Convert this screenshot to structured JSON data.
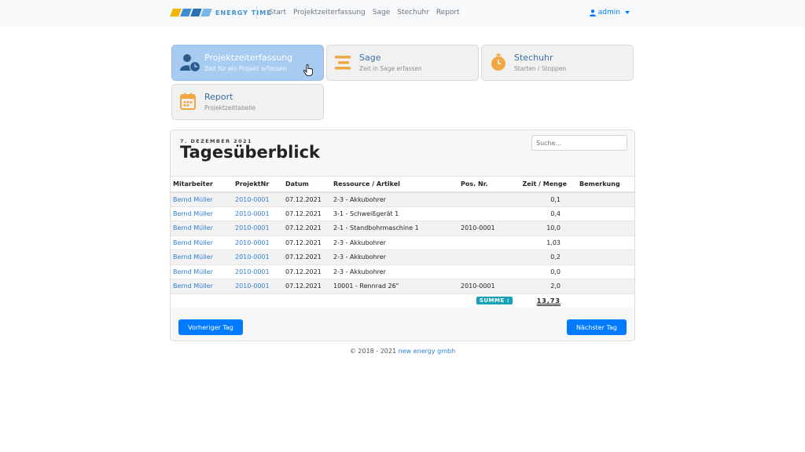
{
  "brand": {
    "name": "ENERGY TIME",
    "logo_colors": [
      "#f2b705",
      "#3d8fd1",
      "#2c6fb3",
      "#79b7e8"
    ]
  },
  "nav": {
    "links": [
      "Start",
      "Projektzeiterfassung",
      "Sage",
      "Stechuhr",
      "Report"
    ]
  },
  "user": {
    "name": "admin"
  },
  "tiles": [
    {
      "title": "Projektzeiterfassung",
      "subtitle": "Zeit für ein Projekt erfassen",
      "icon": "user-clock-icon",
      "active": true
    },
    {
      "title": "Sage",
      "subtitle": "Zeit in Sage erfassen",
      "icon": "align-lines-icon",
      "active": false
    },
    {
      "title": "Stechuhr",
      "subtitle": "Starten / Stoppen",
      "icon": "stopwatch-icon",
      "active": false
    },
    {
      "title": "Report",
      "subtitle": "Projektzeittabelle",
      "icon": "calendar-icon",
      "active": false
    }
  ],
  "overview": {
    "date": "7. DEZEMBER 2021",
    "title": "Tagesüberblick",
    "search_placeholder": "Suche...",
    "columns": [
      "Mitarbeiter",
      "ProjektNr",
      "Datum",
      "Ressource / Artikel",
      "Pos. Nr.",
      "Zeit / Menge",
      "Bemerkung"
    ],
    "rows": [
      {
        "mitarbeiter": "Bernd Müller",
        "projekt": "2010-0001",
        "datum": "07.12.2021",
        "ressource": "2-3 - Akkubohrer",
        "pos": "",
        "menge": "0,1",
        "bemerkung": ""
      },
      {
        "mitarbeiter": "Bernd Müller",
        "projekt": "2010-0001",
        "datum": "07.12.2021",
        "ressource": "3-1 - Schweißgerät 1",
        "pos": "",
        "menge": "0,4",
        "bemerkung": ""
      },
      {
        "mitarbeiter": "Bernd Müller",
        "projekt": "2010-0001",
        "datum": "07.12.2021",
        "ressource": "2-1 - Standbohrmaschine 1",
        "pos": "2010-0001",
        "menge": "10,0",
        "bemerkung": ""
      },
      {
        "mitarbeiter": "Bernd Müller",
        "projekt": "2010-0001",
        "datum": "07.12.2021",
        "ressource": "2-3 - Akkubohrer",
        "pos": "",
        "menge": "1,03",
        "bemerkung": ""
      },
      {
        "mitarbeiter": "Bernd Müller",
        "projekt": "2010-0001",
        "datum": "07.12.2021",
        "ressource": "2-3 - Akkubohrer",
        "pos": "",
        "menge": "0,2",
        "bemerkung": ""
      },
      {
        "mitarbeiter": "Bernd Müller",
        "projekt": "2010-0001",
        "datum": "07.12.2021",
        "ressource": "2-3 - Akkubohrer",
        "pos": "",
        "menge": "0,0",
        "bemerkung": ""
      },
      {
        "mitarbeiter": "Bernd Müller",
        "projekt": "2010-0001",
        "datum": "07.12.2021",
        "ressource": "10001 - Rennrad 26\"",
        "pos": "2010-0001",
        "menge": "2,0",
        "bemerkung": ""
      }
    ],
    "summe_label": "SUMME :",
    "summe_value": "13,73",
    "prev_label": "Vorheriger Tag",
    "next_label": "Nächster Tag"
  },
  "footer": {
    "text": "© 2018 - 2021 ",
    "link": "new energy gmbh"
  },
  "colors": {
    "accent": "#007bff",
    "tile_active": "#a7cbf1",
    "icon_orange": "#f0a845",
    "highlight": "#f1c488",
    "summe_badge": "#17a2b8"
  }
}
